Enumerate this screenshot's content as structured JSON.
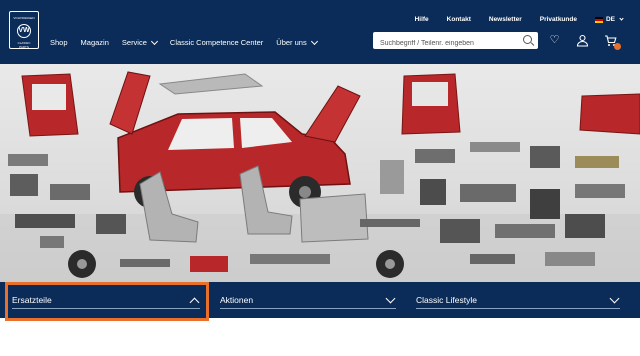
{
  "logo": {
    "line1": "VOLKSWAGEN",
    "mark": "VW",
    "line2": "CLASSIC PARTS"
  },
  "topnav": [
    "Hilfe",
    "Kontakt",
    "Newsletter",
    "Privatkunde"
  ],
  "language": "DE",
  "mainnav": [
    {
      "label": "Shop",
      "dropdown": false
    },
    {
      "label": "Magazin",
      "dropdown": false
    },
    {
      "label": "Service",
      "dropdown": true
    },
    {
      "label": "Classic Competence Center",
      "dropdown": false
    },
    {
      "label": "Über uns",
      "dropdown": true
    }
  ],
  "search": {
    "placeholder": "Suchbegriff / Teilenr. eingeben",
    "value": ""
  },
  "header_icons": [
    "heart-icon",
    "user-icon",
    "cart-icon"
  ],
  "tabs": [
    {
      "label": "Ersatzteile",
      "expanded": true
    },
    {
      "label": "Aktionen",
      "expanded": false
    },
    {
      "label": "Classic Lifestyle",
      "expanded": false
    }
  ],
  "colors": {
    "navy": "#0b2c59",
    "accent": "#e8702a",
    "car_red": "#b8282a"
  }
}
